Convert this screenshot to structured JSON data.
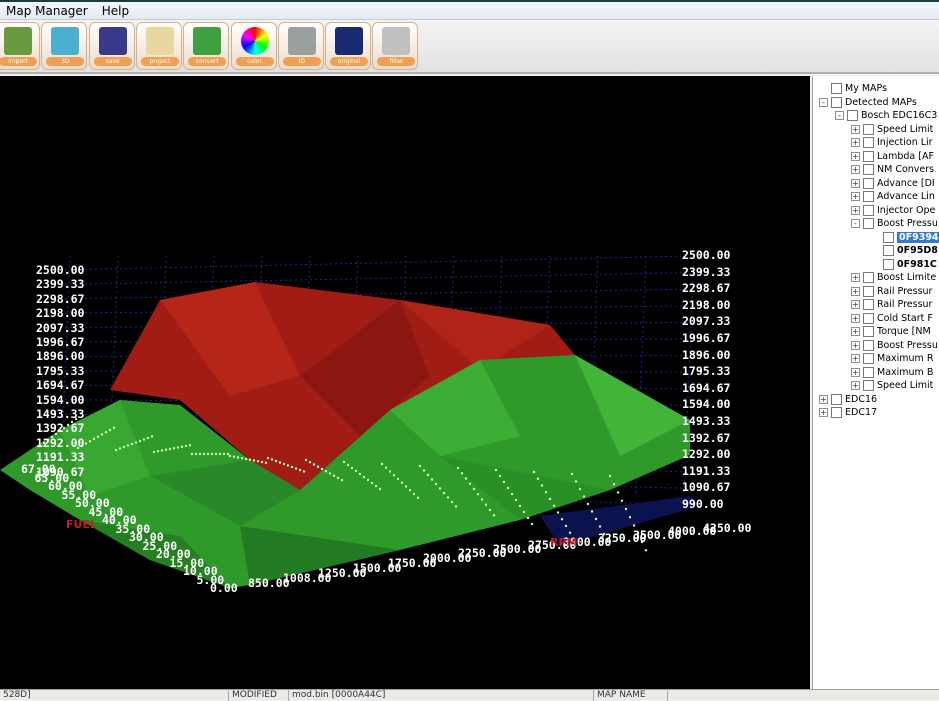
{
  "menu": [
    "Map Manager",
    "Help"
  ],
  "toolbar": [
    {
      "icon": "import-icon",
      "label": "import"
    },
    {
      "icon": "3d-shapes-icon",
      "label": "3D"
    },
    {
      "icon": "save-icon",
      "label": "save"
    },
    {
      "icon": "pencil-icon",
      "label": "project"
    },
    {
      "icon": "convert-icon",
      "label": "convert"
    },
    {
      "icon": "color-wheel-icon",
      "label": "color"
    },
    {
      "icon": "calculator-icon",
      "label": "ID"
    },
    {
      "icon": "original-icon",
      "label": "original"
    },
    {
      "icon": "filter-icon",
      "label": "filter"
    }
  ],
  "chart_data": {
    "type": "3d-surface",
    "z_ticks_left": [
      "2500.00",
      "2399.33",
      "2298.67",
      "2198.00",
      "2097.33",
      "1996.67",
      "1896.00",
      "1795.33",
      "1694.67",
      "1594.00",
      "1493.33",
      "1392.67",
      "1292.00",
      "1191.33",
      "1090.67"
    ],
    "z_ticks_right": [
      "2500.00",
      "2399.33",
      "2298.67",
      "2198.00",
      "2097.33",
      "1996.67",
      "1896.00",
      "1795.33",
      "1694.67",
      "1594.00",
      "1493.33",
      "1392.67",
      "1292.00",
      "1191.33",
      "1090.67",
      "990.00"
    ],
    "x_title": "RPM",
    "x_ticks": [
      "850.00",
      "1008.00",
      "1250.00",
      "1500.00",
      "1750.00",
      "2000.00",
      "2250.00",
      "2500.00",
      "2750.00",
      "3000.00",
      "3250.00",
      "3500.00",
      "4000.00",
      "4250.00"
    ],
    "y_title": "FUEL",
    "y_ticks": [
      "0.00",
      "5.00",
      "10.00",
      "15.00",
      "20.00",
      "25.00",
      "30.00",
      "35.00",
      "40.00",
      "45.00",
      "50.00",
      "55.00",
      "60.00",
      "65.00",
      "67.00"
    ],
    "series": [
      {
        "name": "original",
        "color": "#2f9a2a"
      },
      {
        "name": "modified",
        "color": "#a01c14"
      }
    ]
  },
  "tree": [
    {
      "label": "My MAPs",
      "level": 0,
      "exp": ""
    },
    {
      "label": "Detected MAPs",
      "level": 0,
      "exp": "-"
    },
    {
      "label": "Bosch EDC16C3",
      "level": 1,
      "exp": "-"
    },
    {
      "label": "Speed Limit",
      "level": 2,
      "exp": "+"
    },
    {
      "label": "Injection Lir",
      "level": 2,
      "exp": "+"
    },
    {
      "label": "Lambda [AF",
      "level": 2,
      "exp": "+"
    },
    {
      "label": "NM Convers",
      "level": 2,
      "exp": "+"
    },
    {
      "label": "Advance [DI",
      "level": 2,
      "exp": "+"
    },
    {
      "label": "Advance Lin",
      "level": 2,
      "exp": "+"
    },
    {
      "label": "Injector Ope",
      "level": 2,
      "exp": "+"
    },
    {
      "label": "Boost Pressu",
      "level": 2,
      "exp": "-"
    },
    {
      "label": "0F9394",
      "level": 3,
      "exp": "",
      "sel": true
    },
    {
      "label": "0F95D8",
      "level": 3,
      "exp": ""
    },
    {
      "label": "0F981C",
      "level": 3,
      "exp": ""
    },
    {
      "label": "Boost Limite",
      "level": 2,
      "exp": "+"
    },
    {
      "label": "Rail Pressur",
      "level": 2,
      "exp": "+"
    },
    {
      "label": "Rail Pressur",
      "level": 2,
      "exp": "+"
    },
    {
      "label": "Cold Start F",
      "level": 2,
      "exp": "+"
    },
    {
      "label": "Torque [NM",
      "level": 2,
      "exp": "+"
    },
    {
      "label": "Boost Pressu",
      "level": 2,
      "exp": "+"
    },
    {
      "label": "Maximum R",
      "level": 2,
      "exp": "+"
    },
    {
      "label": "Maximum B",
      "level": 2,
      "exp": "+"
    },
    {
      "label": "Speed Limit",
      "level": 2,
      "exp": "+"
    },
    {
      "label": "EDC16",
      "level": 0,
      "exp": "+"
    },
    {
      "label": "EDC17",
      "level": 0,
      "exp": "+"
    }
  ],
  "status": {
    "addr": "528D]",
    "state": "MODIFIED",
    "file": "mod.bin [0000A44C]",
    "mapname": "MAP NAME"
  }
}
